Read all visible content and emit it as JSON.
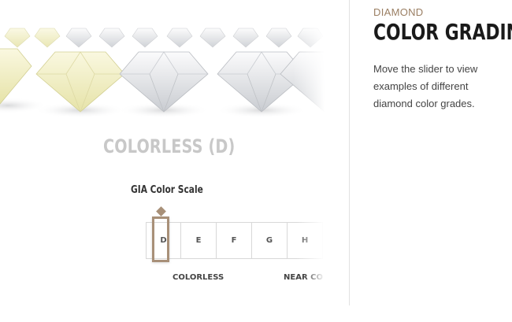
{
  "diamond_visual": {
    "grade": "D",
    "colors": {
      "yellow_tint": "#f2f0c4",
      "clear": "#e9ebee",
      "accent": "#a89078"
    }
  },
  "selected_grade_title": "COLORLESS (D)",
  "scale": {
    "label": "GIA Color Scale",
    "grades": [
      "D",
      "E",
      "F",
      "G",
      "H"
    ],
    "selected": "D",
    "categories": [
      "COLORLESS",
      "NEAR CO"
    ]
  },
  "info": {
    "eyebrow": "DIAMOND",
    "title": "COLOR GRADING",
    "description": "Move the slider to view examples of different diamond color grades."
  }
}
